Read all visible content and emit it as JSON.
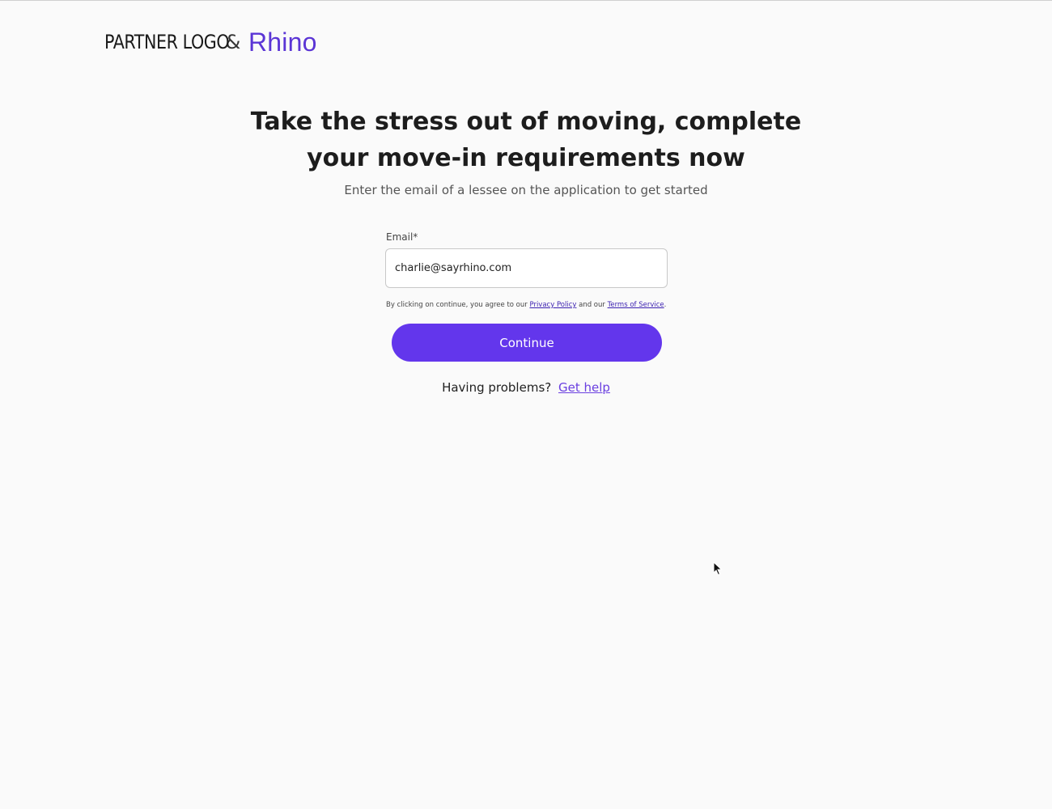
{
  "header": {
    "partner_logo": "PARTNER LOGO",
    "separator": "&",
    "brand_name": "Rhino"
  },
  "hero": {
    "headline_line1": "Take the stress out of moving, complete",
    "headline_line2": "your move-in requirements now",
    "subheadline": "Enter the email of a lessee on the application to get started"
  },
  "form": {
    "email_label": "Email*",
    "email_value": "charlie@sayrhino.com",
    "consent_prefix": "By clicking on continue, you agree to our ",
    "privacy_link": "Privacy Policy",
    "consent_middle": " and our ",
    "terms_link": "Terms of Service",
    "consent_suffix": ".",
    "continue_label": "Continue"
  },
  "help": {
    "prompt": "Having problems?",
    "link": "Get help"
  },
  "colors": {
    "accent": "#6336ec",
    "brand": "#5b35d5",
    "link": "#3a1fb0",
    "background": "#fafafa"
  },
  "icons": {
    "cursor": "mouse-pointer-icon"
  }
}
